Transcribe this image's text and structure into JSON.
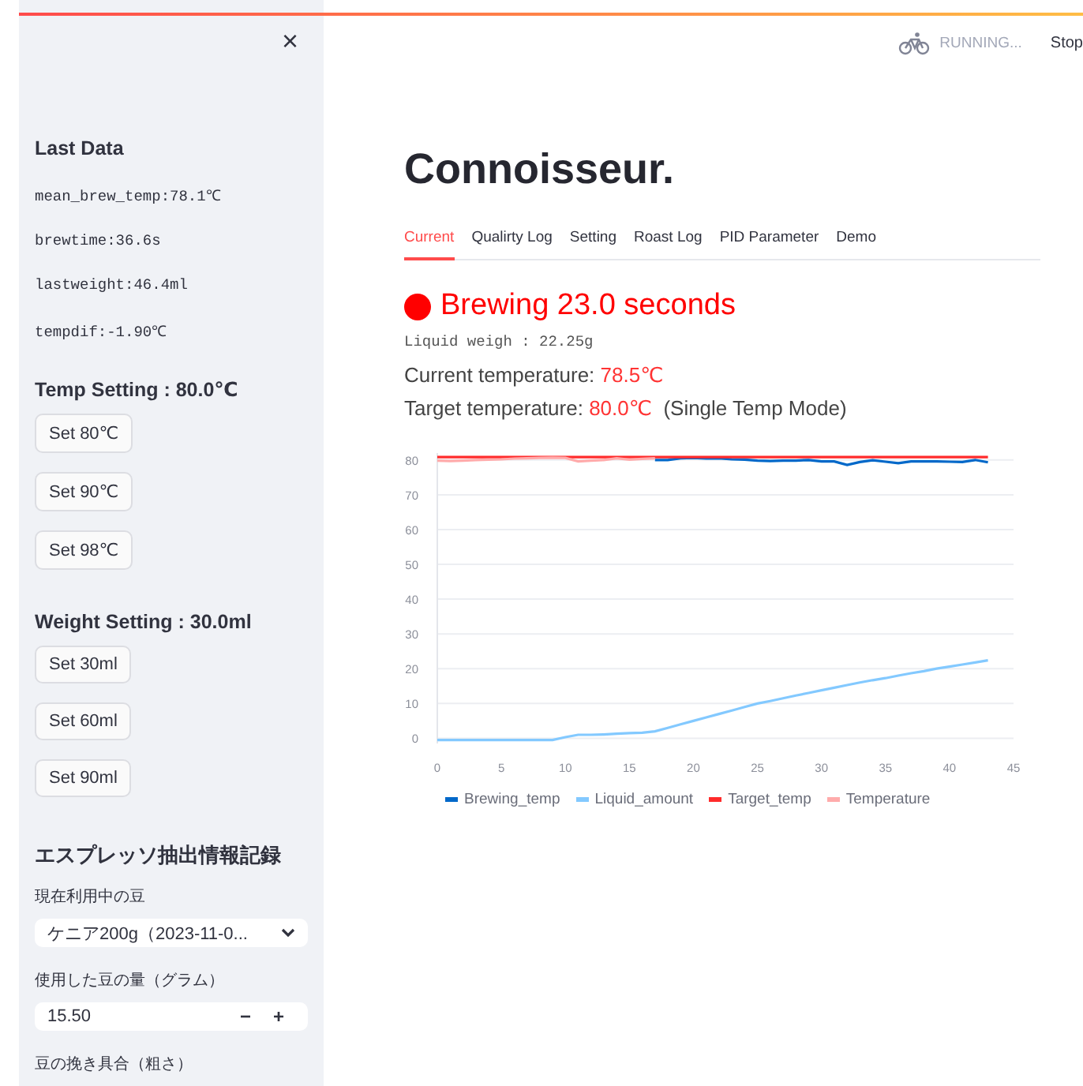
{
  "header": {
    "status": "RUNNING...",
    "stop": "Stop"
  },
  "sidebar": {
    "close": "×",
    "last_data": {
      "title": "Last Data",
      "lines": [
        "mean_brew_temp:78.1℃",
        "brewtime:36.6s",
        "lastweight:46.4ml",
        "tempdif:-1.90℃"
      ]
    },
    "temp_setting": {
      "title": "Temp Setting : 80.0℃",
      "buttons": [
        "Set 80℃",
        "Set 90℃",
        "Set 98℃"
      ]
    },
    "weight_setting": {
      "title": "Weight Setting : 30.0ml",
      "buttons": [
        "Set 30ml",
        "Set 60ml",
        "Set 90ml"
      ]
    },
    "record": {
      "title": "エスプレッソ抽出情報記録",
      "fields": [
        {
          "kind": "select",
          "label": "現在利用中の豆",
          "value": "ケニア200g（2023-11-0..."
        },
        {
          "kind": "number",
          "label": "使用した豆の量（グラム）",
          "value": "15.50",
          "minus": "−",
          "plus": "+"
        },
        {
          "kind": "label",
          "label": "豆の挽き具合（粗さ）"
        }
      ]
    }
  },
  "main": {
    "title": "Connoisseur.",
    "tabs": [
      {
        "label": "Current",
        "selected": true
      },
      {
        "label": "Qualirty Log",
        "selected": false
      },
      {
        "label": "Setting",
        "selected": false
      },
      {
        "label": "Roast Log",
        "selected": false
      },
      {
        "label": "PID Parameter",
        "selected": false
      },
      {
        "label": "Demo",
        "selected": false
      }
    ],
    "brewing": {
      "text": "Brewing 23.0 seconds",
      "color": "#ff0000"
    },
    "liquid": "Liquid weigh : 22.25g",
    "current_temp": {
      "label": "Current temperature:",
      "value": "78.5℃"
    },
    "target_temp": {
      "label": "Target temperature:",
      "value": "80.0℃",
      "mode": "(Single Temp Mode)"
    },
    "chart_data": {
      "type": "line",
      "x": [
        0,
        1,
        2,
        3,
        4,
        5,
        6,
        7,
        8,
        9,
        10,
        11,
        12,
        13,
        14,
        15,
        16,
        17,
        18,
        19,
        20,
        21,
        22,
        23,
        24,
        25,
        26,
        27,
        28,
        29,
        30,
        31,
        32,
        33,
        34,
        35,
        36,
        37,
        38,
        39,
        40,
        41,
        42,
        43
      ],
      "series": [
        {
          "name": "Brewing_temp",
          "color": "#0068c9",
          "values": [
            null,
            null,
            null,
            null,
            null,
            null,
            null,
            null,
            null,
            null,
            null,
            null,
            null,
            null,
            null,
            null,
            null,
            80,
            80,
            80.5,
            80.6,
            80.4,
            80.5,
            80.2,
            80.1,
            79.8,
            79.7,
            79.8,
            79.8,
            80,
            79.6,
            79.6,
            78.6,
            79.4,
            79.9,
            79.5,
            79.1,
            79.6,
            79.6,
            79.6,
            79.5,
            79.4,
            80,
            79.3
          ]
        },
        {
          "name": "Liquid_amount",
          "color": "#83c9ff",
          "values": [
            -0.5,
            -0.5,
            -0.5,
            -0.5,
            -0.5,
            -0.5,
            -0.5,
            -0.5,
            -0.5,
            -0.5,
            0.3,
            1,
            1,
            1.1,
            1.3,
            1.5,
            1.6,
            2,
            3,
            4,
            5,
            6,
            7,
            8,
            9,
            10,
            10.7,
            11.5,
            12.3,
            13,
            13.8,
            14.5,
            15.3,
            16,
            16.7,
            17.3,
            18,
            18.7,
            19.3,
            20,
            20.6,
            21.2,
            21.8,
            22.4
          ]
        },
        {
          "name": "Target_temp",
          "color": "#ff2b2b",
          "values": [
            80.8,
            80.8,
            80.8,
            80.8,
            80.8,
            80.8,
            80.8,
            80.8,
            80.8,
            80.8,
            80.8,
            80.8,
            80.8,
            80.8,
            80.8,
            80.8,
            80.8,
            80.8,
            80.8,
            80.8,
            80.8,
            80.8,
            80.8,
            80.8,
            80.8,
            80.8,
            80.8,
            80.8,
            80.8,
            80.8,
            80.8,
            80.8,
            80.8,
            80.8,
            80.8,
            80.8,
            80.8,
            80.8,
            80.8,
            80.8,
            80.8,
            80.8,
            80.8,
            80.8
          ]
        },
        {
          "name": "Temperature",
          "color": "#ffabab",
          "values": [
            79.8,
            79.7,
            79.8,
            80,
            80.1,
            80.2,
            80.4,
            80.5,
            80.6,
            80.7,
            80.6,
            79.6,
            79.8,
            80,
            80.5,
            80.1,
            80.3,
            80.5,
            null,
            null,
            null,
            null,
            null,
            null,
            null,
            null,
            null,
            null,
            null,
            null,
            null,
            null,
            null,
            null,
            null,
            null,
            null,
            null,
            null,
            null,
            null,
            null,
            null,
            null
          ]
        }
      ],
      "xlim": [
        0,
        45
      ],
      "ylim": [
        -1.5,
        82
      ],
      "grid": true,
      "legend": "bottom",
      "xticks": [
        0,
        5,
        10,
        15,
        20,
        25,
        30,
        35,
        40,
        45
      ],
      "yticks": [
        0,
        10,
        20,
        30,
        40,
        50,
        60,
        70,
        80
      ]
    }
  }
}
